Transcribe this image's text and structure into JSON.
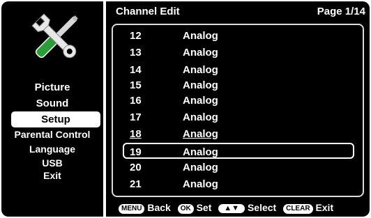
{
  "menu": {
    "items": [
      {
        "label": "Picture"
      },
      {
        "label": "Sound"
      },
      {
        "label": "Setup"
      },
      {
        "label": "Parental Control"
      },
      {
        "label": "Language"
      },
      {
        "label": "USB"
      },
      {
        "label": "Exit"
      }
    ],
    "selected": "Setup",
    "icon": "tools-icon"
  },
  "header": {
    "title": "Channel Edit",
    "page": "Page 1/14"
  },
  "channels": [
    {
      "number": "12",
      "type": "Analog"
    },
    {
      "number": "13",
      "type": "Analog"
    },
    {
      "number": "14",
      "type": "Analog"
    },
    {
      "number": "15",
      "type": "Analog"
    },
    {
      "number": "16",
      "type": "Analog"
    },
    {
      "number": "17",
      "type": "Analog"
    },
    {
      "number": "18",
      "type": "Analog"
    },
    {
      "number": "19",
      "type": "Analog"
    },
    {
      "number": "20",
      "type": "Analog"
    },
    {
      "number": "21",
      "type": "Analog"
    }
  ],
  "selected_channel": "19",
  "footer": {
    "menu_key": "MENU",
    "back_label": "Back",
    "ok_key": "OK",
    "set_label": "Set",
    "updown_key": "updown-arrows-icon",
    "select_label": "Select",
    "clear_key": "CLEAR",
    "exit_label": "Exit"
  },
  "colors": {
    "panel_bg": "#000000",
    "text": "#ffffff",
    "highlight_bg": "#ffffff"
  }
}
